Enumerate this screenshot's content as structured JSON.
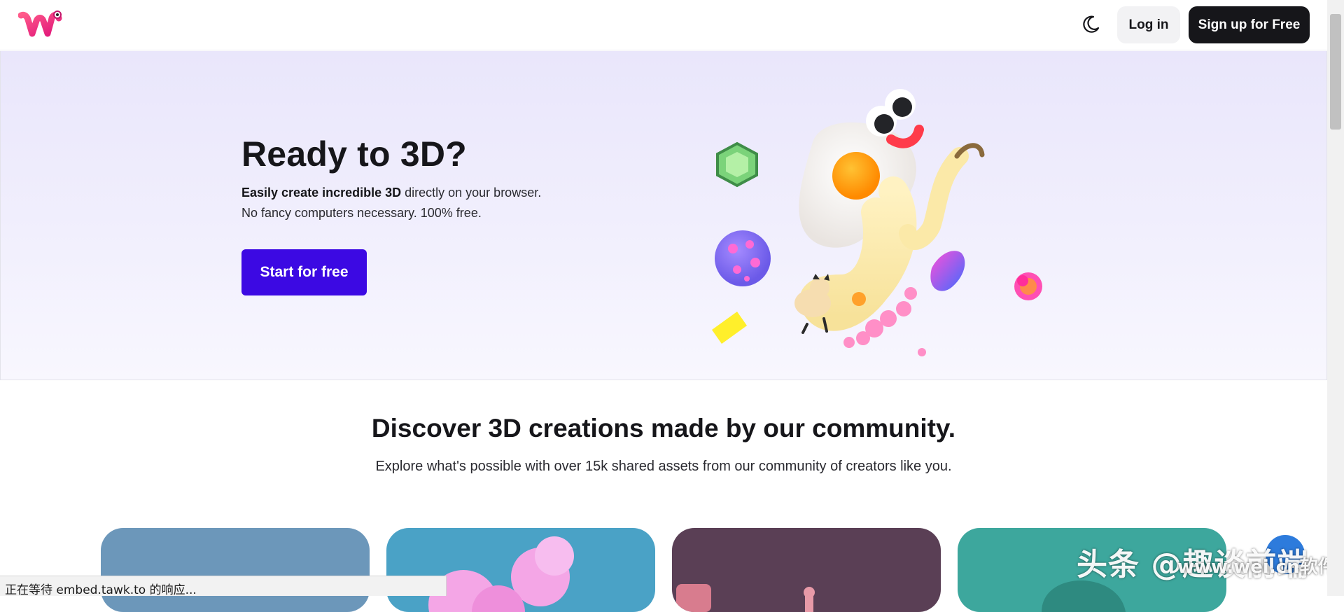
{
  "nav": {
    "logo_icon": "weird-w-logo",
    "theme_icon": "moon-icon",
    "login_label": "Log in",
    "signup_label": "Sign up for Free"
  },
  "hero": {
    "title": "Ready to 3D?",
    "line1_bold": "Easily create incredible 3D",
    "line1_rest": " directly on your browser.",
    "line2": "No fancy computers necessary. 100% free.",
    "cta_label": "Start for free",
    "cta_color": "#3c09e3"
  },
  "discover": {
    "title": "Discover 3D creations made by our community.",
    "subtitle": "Explore what's possible with over 15k shared assets from our community of creators like you.",
    "card_colors": [
      "#6c97ba",
      "#4aa2c6",
      "#5a3f55",
      "#3da79d"
    ]
  },
  "status_bar": {
    "text": "正在等待 embed.tawk.to 的响应..."
  },
  "watermark": {
    "text": "头条 @趣谈前端",
    "secondary": "www.wei.cn软件网"
  }
}
